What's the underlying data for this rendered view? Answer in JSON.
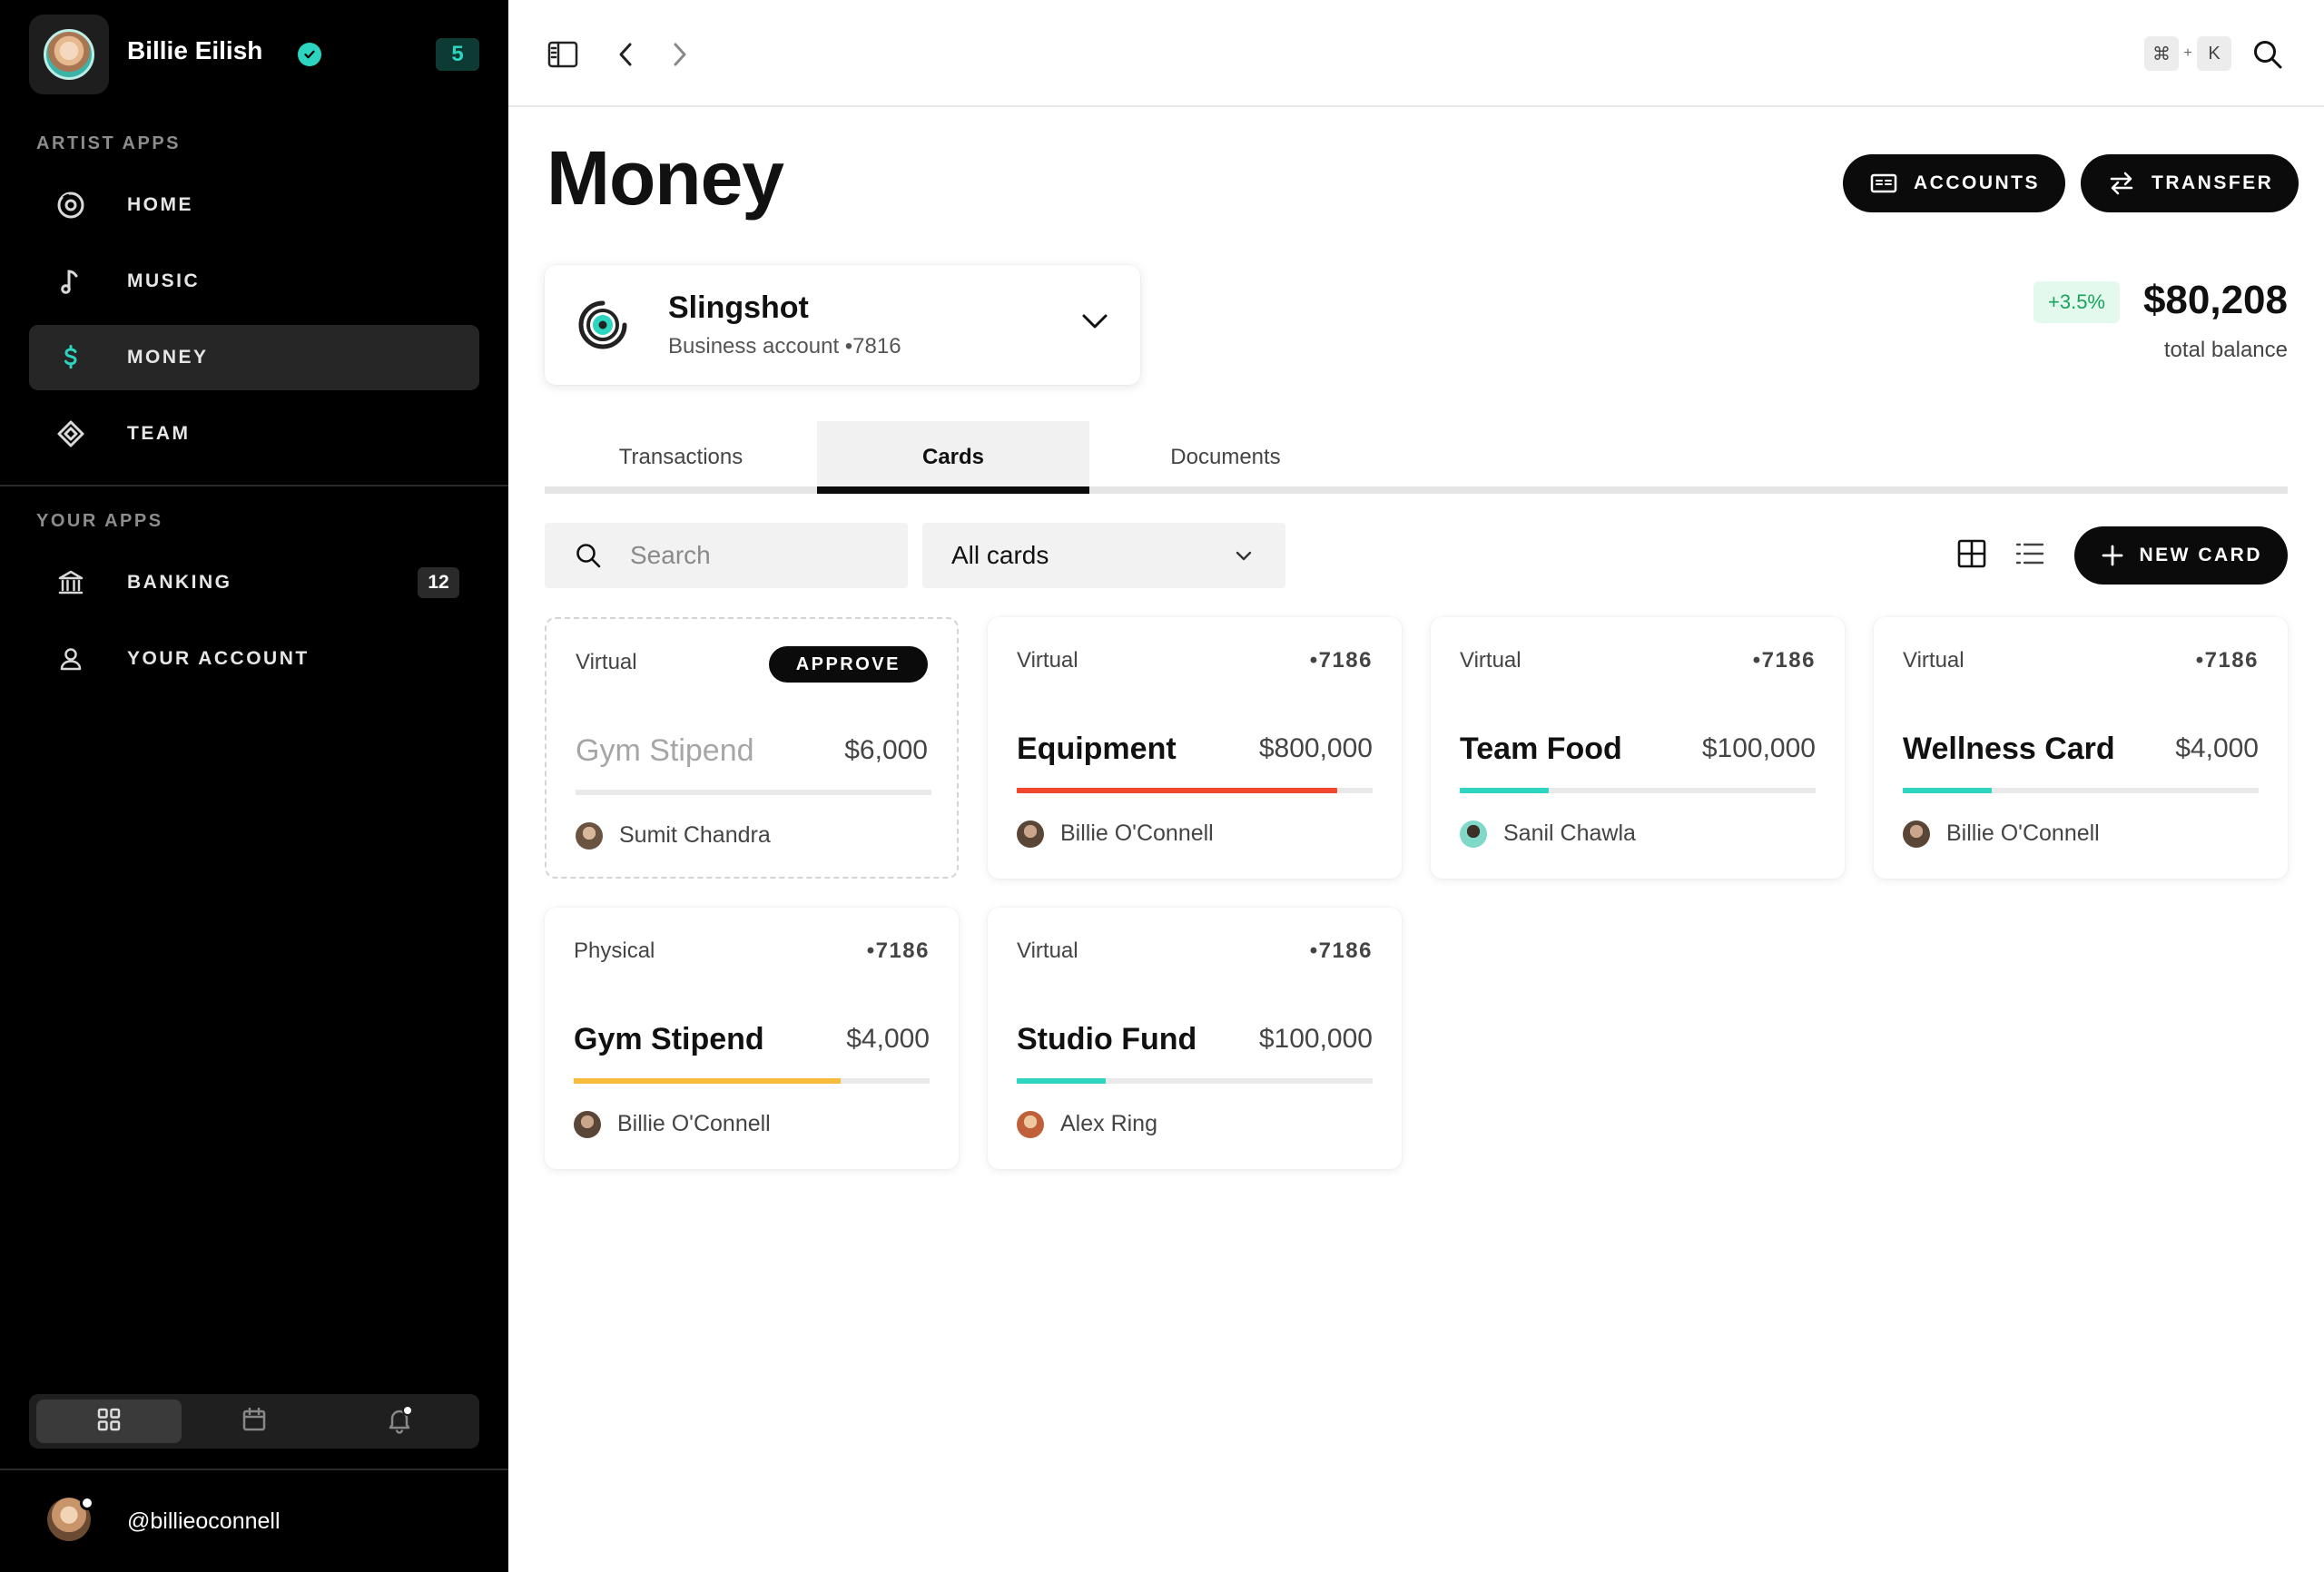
{
  "profile": {
    "name": "Billie Eilish",
    "badge_count": "5"
  },
  "sidebar": {
    "artist_apps_label": "ARTIST APPS",
    "artist_items": [
      {
        "label": "HOME",
        "icon": "vinyl-icon",
        "active": false
      },
      {
        "label": "MUSIC",
        "icon": "music-note-icon",
        "active": false
      },
      {
        "label": "MONEY",
        "icon": "dollar-icon",
        "active": true
      },
      {
        "label": "TEAM",
        "icon": "diamond-icon",
        "active": false
      }
    ],
    "your_apps_label": "YOUR APPS",
    "your_items": [
      {
        "label": "BANKING",
        "icon": "bank-icon",
        "count": "12"
      },
      {
        "label": "YOUR ACCOUNT",
        "icon": "user-icon",
        "count": ""
      }
    ],
    "footer_handle": "@billieoconnell"
  },
  "topbar": {
    "shortcut_mod": "⌘",
    "shortcut_plus": "+",
    "shortcut_key": "K"
  },
  "page": {
    "title": "Money",
    "accounts_label": "ACCOUNTS",
    "transfer_label": "TRANSFER"
  },
  "account": {
    "name": "Slingshot",
    "subtitle": "Business account •7816"
  },
  "balance": {
    "change": "+3.5%",
    "value": "$80,208",
    "label": "total balance"
  },
  "tabs": [
    {
      "label": "Transactions",
      "active": false
    },
    {
      "label": "Cards",
      "active": true
    },
    {
      "label": "Documents",
      "active": false
    }
  ],
  "filters": {
    "search_placeholder": "Search",
    "select_value": "All cards",
    "new_card_label": "NEW CARD"
  },
  "cards": [
    {
      "type": "Virtual",
      "last4": "",
      "approve": "APPROVE",
      "name": "Gym Stipend",
      "amount": "$6,000",
      "progress": 0,
      "color": "#e9e9e9",
      "holder": "Sumit Chandra",
      "pending": true
    },
    {
      "type": "Virtual",
      "last4": "•7186",
      "approve": "",
      "name": "Equipment",
      "amount": "$800,000",
      "progress": 0.9,
      "color": "#f0472e",
      "holder": "Billie O'Connell",
      "pending": false
    },
    {
      "type": "Virtual",
      "last4": "•7186",
      "approve": "",
      "name": "Team Food",
      "amount": "$100,000",
      "progress": 0.25,
      "color": "#2dd4bf",
      "holder": "Sanil Chawla",
      "pending": false
    },
    {
      "type": "Virtual",
      "last4": "•7186",
      "approve": "",
      "name": "Wellness Card",
      "amount": "$4,000",
      "progress": 0.25,
      "color": "#2dd4bf",
      "holder": "Billie O'Connell",
      "pending": false
    },
    {
      "type": "Physical",
      "last4": "•7186",
      "approve": "",
      "name": "Gym Stipend",
      "amount": "$4,000",
      "progress": 0.75,
      "color": "#f7bb3b",
      "holder": "Billie O'Connell",
      "pending": false
    },
    {
      "type": "Virtual",
      "last4": "•7186",
      "approve": "",
      "name": "Studio Fund",
      "amount": "$100,000",
      "progress": 0.25,
      "color": "#2dd4bf",
      "holder": "Alex Ring",
      "pending": false
    }
  ]
}
